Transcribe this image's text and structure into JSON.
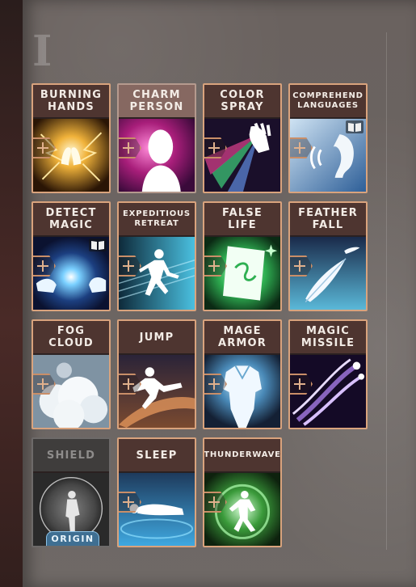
{
  "level": {
    "numeral": "I"
  },
  "spells": [
    {
      "title": "BURNING HANDS",
      "state": "normal",
      "known_book": false,
      "icon": "burning-hands-icon"
    },
    {
      "title": "CHARM PERSON",
      "state": "selected",
      "known_book": false,
      "icon": "charm-person-icon"
    },
    {
      "title": "COLOR SPRAY",
      "state": "normal",
      "known_book": false,
      "icon": "color-spray-icon"
    },
    {
      "title": "COMPREHEND LANGUAGES",
      "state": "normal",
      "known_book": true,
      "icon": "comprehend-languages-icon"
    },
    {
      "title": "DETECT MAGIC",
      "state": "normal",
      "known_book": true,
      "icon": "detect-magic-icon"
    },
    {
      "title": "EXPEDITIOUS RETREAT",
      "state": "normal",
      "known_book": false,
      "icon": "expeditious-retreat-icon"
    },
    {
      "title": "FALSE LIFE",
      "state": "normal",
      "known_book": false,
      "icon": "false-life-icon"
    },
    {
      "title": "FEATHER FALL",
      "state": "normal",
      "known_book": false,
      "icon": "feather-fall-icon"
    },
    {
      "title": "FOG CLOUD",
      "state": "normal",
      "known_book": false,
      "icon": "fog-cloud-icon"
    },
    {
      "title": "JUMP",
      "state": "normal",
      "known_book": false,
      "icon": "jump-icon"
    },
    {
      "title": "MAGE ARMOR",
      "state": "normal",
      "known_book": false,
      "icon": "mage-armor-icon"
    },
    {
      "title": "MAGIC MISSILE",
      "state": "normal",
      "known_book": false,
      "icon": "magic-missile-icon"
    },
    {
      "title": "SHIELD",
      "state": "disabled",
      "known_book": false,
      "icon": "shield-icon",
      "tag": "ORIGIN"
    },
    {
      "title": "SLEEP",
      "state": "normal",
      "known_book": false,
      "icon": "sleep-icon"
    },
    {
      "title": "THUNDERWAVE",
      "state": "normal",
      "known_book": false,
      "icon": "thunderwave-icon"
    }
  ],
  "colors": {
    "card_border": "#d9a37d",
    "title_bg": "#4e3530",
    "selected_title_bg": "#866861",
    "origin_tag": "#3f6f92"
  }
}
